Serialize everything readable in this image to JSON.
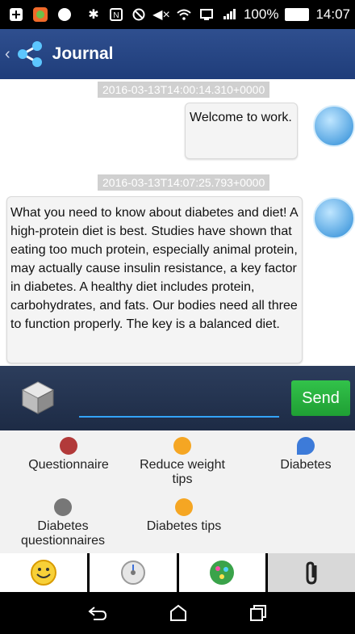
{
  "status_bar": {
    "battery": "100%",
    "time": "14:07",
    "icons": [
      "add-icon",
      "app-icon",
      "dot-icon",
      "bluetooth-icon",
      "nfc-icon",
      "no-disturb-icon",
      "mute-icon",
      "wifi-icon",
      "cast-icon",
      "signal-icon",
      "battery-icon"
    ]
  },
  "header": {
    "title": "Journal",
    "icon": "share-icon"
  },
  "messages": [
    {
      "timestamp": "2016-03-13T14:00:14.310+0000",
      "text": "Welcome to work."
    },
    {
      "timestamp": "2016-03-13T14:07:25.793+0000",
      "text": "What you need to know about diabetes and diet! A high-protein diet is best. Studies have shown that eating too much protein, especially animal protein, may actually cause insulin resistance, a key factor in diabetes. A healthy diet includes protein, carbohydrates, and fats. Our bodies need all three to function properly. The key is a balanced diet."
    }
  ],
  "input": {
    "value": "",
    "send_label": "Send"
  },
  "quick_actions": [
    {
      "label": "Questionnaire",
      "icon": "questionnaire-icon",
      "color": "#b23a3a"
    },
    {
      "label": "Reduce weight tips",
      "icon": "search-icon",
      "color": "#f5a623"
    },
    {
      "label": "Diabetes",
      "icon": "blood-drop-icon",
      "color": "#3d7bd9"
    },
    {
      "label": "Diabetes questionnaires",
      "icon": "clipboard-icon",
      "color": "#777777"
    },
    {
      "label": "Diabetes tips",
      "icon": "search-icon",
      "color": "#f5a623"
    }
  ],
  "tabs": [
    {
      "icon": "smiley-icon",
      "selected": false
    },
    {
      "icon": "calculator-dial-icon",
      "selected": false
    },
    {
      "icon": "molecule-icon",
      "selected": false
    },
    {
      "icon": "paperclip-icon",
      "selected": true
    }
  ],
  "colors": {
    "appbar": "#2f4f8f",
    "send": "#2db144",
    "accent_line": "#33a3ff"
  }
}
